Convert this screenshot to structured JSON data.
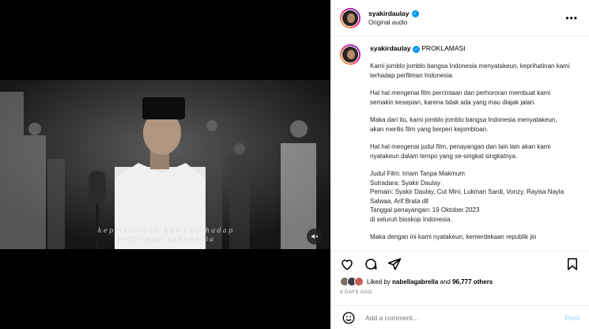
{
  "post": {
    "username": "syakirdaulay",
    "audio": "Original audio",
    "more_icon": "more-horizontal-icon"
  },
  "video": {
    "subtitle_line1": "keprihatinan kami terhadap",
    "subtitle_line2": "perfilman Indonesia",
    "mute_icon": "speaker-muted-icon"
  },
  "caption": {
    "username": "syakirdaulay",
    "title": "PROKLAMASI",
    "paragraphs": [
      "Kami jomblo jomblo bangsa Indonesia menyatakeun, keprihatinan kami terhadap perfilman Indonesia.",
      "Hal hal mengenai film percintaan dan perhororan membuat kami semakin kesepian, karena tidak ada yang mau diajak jalan.",
      "Maka dari itu, kami jomblo jomblo bangsa Indonesia menyatakeun, akan merilis film yang berperi kejombloan.",
      "Hal hal mengenai judul film, penayangan dan lain lain akan kami nyatakeun dalam tempo yang se-singkat singkatnya.",
      "Judul Film: Imam Tanpa Makmum\nSutradara: Syakir Daulay\nPemain: Syakir Daulay, Cut Mini, Lukman Sardi, Vonzy, Rayisa Nayla Salwaa, Arif Brata dll\nTanggal penayangan: 19 Oktober 2023\ndi seluruh bioskop Indonesia.",
      "Maka dengan ini kami nyatakeun, kemerdekaan republik jio"
    ]
  },
  "actions": {
    "like_icon": "heart-icon",
    "comment_icon": "comment-icon",
    "share_icon": "share-icon",
    "save_icon": "bookmark-icon"
  },
  "likes": {
    "prefix": "Liked by",
    "user": "nabellagabrella",
    "connector": "and",
    "count": "96,777 others"
  },
  "date": "4 DAYS AGO",
  "comment": {
    "placeholder": "Add a comment...",
    "post_label": "Post",
    "emoji_icon": "smiley-icon"
  },
  "colors": {
    "accent": "#0095f6",
    "backdrop": "#8c8c8c"
  }
}
